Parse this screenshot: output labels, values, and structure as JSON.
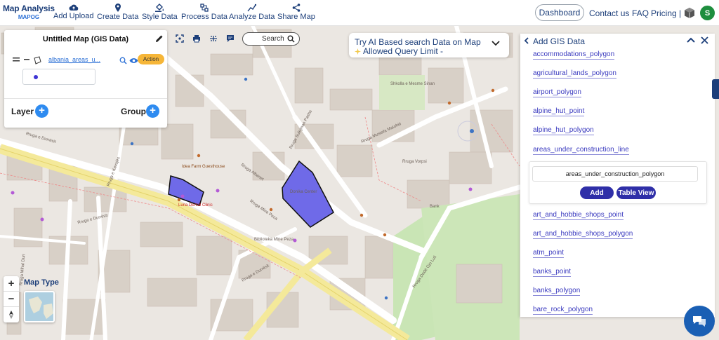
{
  "app": {
    "logo_title": "Map Analysis",
    "logo_sub": "MAPOG"
  },
  "nav": [
    {
      "label": "Add Upload",
      "icon": "cloud-upload-icon"
    },
    {
      "label": "Create Data",
      "icon": "map-pin-icon"
    },
    {
      "label": "Style Data",
      "icon": "paint-bucket-icon"
    },
    {
      "label": "Process Data",
      "icon": "process-icon"
    },
    {
      "label": "Analyze Data",
      "icon": "analyze-icon"
    },
    {
      "label": "Share Map",
      "icon": "share-icon"
    }
  ],
  "nav_right": {
    "dashboard": "Dashboard",
    "contact": "Contact us",
    "faq": "FAQ",
    "pricing": "Pricing |",
    "avatar_initial": "S"
  },
  "layer_panel": {
    "title": "Untitled Map (GIS Data)",
    "layer_name": "albania_areas_u...",
    "action_label": "Action",
    "layer_label": "Layer",
    "group_label": "Group",
    "legend_color": "#3f35d4"
  },
  "toolbar": {
    "search_label": "Search"
  },
  "ai_box": {
    "line1": "Try AI Based search Data on Map",
    "line2": "Allowed Query Limit -"
  },
  "gis_panel": {
    "title": "Add GIS Data",
    "items_before": [
      "accommodations_polygon",
      "agricultural_lands_polygon",
      "airport_polygon",
      "alpine_hut_point",
      "alpine_hut_polygon",
      "areas_under_construction_line"
    ],
    "selected": {
      "name": "areas_under_construction_polygon",
      "add_label": "Add",
      "table_label": "Table View"
    },
    "items_after": [
      "art_and_hobbie_shops_point",
      "art_and_hobbie_shops_polygon",
      "atm_point",
      "banks_point",
      "banks_polygon",
      "bare_rock_polygon"
    ]
  },
  "map_controls": {
    "zoom_in": "+",
    "zoom_out": "−",
    "map_type_label": "Map Type"
  },
  "map_labels": {
    "street1": "Rruga e Durrësit",
    "street2": "Rruga Albanet",
    "street3": "Rruga Mine Peza",
    "street4": "Rruga e Durrësit",
    "street5": "Rruga Dedë Gjo Luli",
    "street6": "Rruga e Durrësit",
    "street7": "Rruga Vorpsi",
    "poi1": "Luna Dental Clinic",
    "poi2": "Idea Farm Guesthouse",
    "poi3": "Donika Center",
    "poi4": "Shkolla e Mesme Sinan",
    "poi5": "Biblioteka Mine Peza",
    "poi6": "Bank",
    "poi7": "Rruga Sulejman Pasha",
    "poi8": "Rruga Mustafa Matohiti",
    "poi9": "Rruga Mihal Duri",
    "poi10": "Rruga e Kavajës"
  },
  "colors": {
    "accent": "#1d3f7a",
    "polygon_fill": "#6f6ae8",
    "action": "#f6b638",
    "plus": "#2e8bf0",
    "gis_button": "#2f2fa8"
  }
}
